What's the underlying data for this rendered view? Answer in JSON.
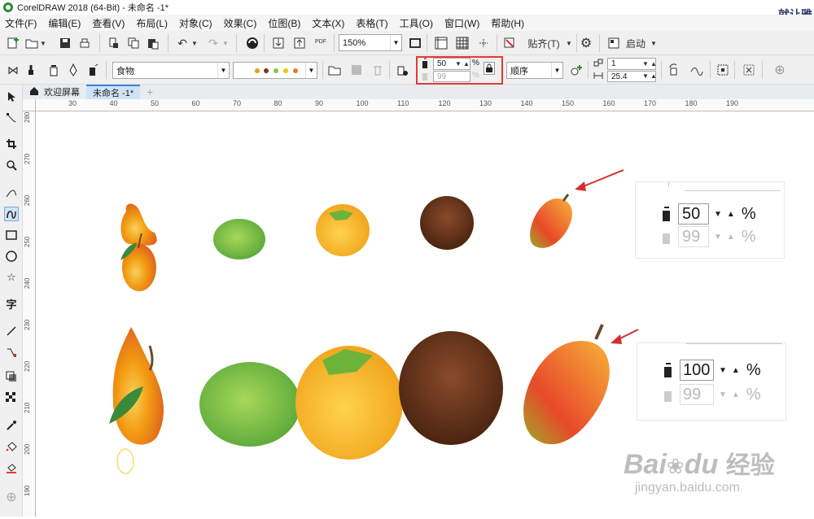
{
  "window": {
    "title": "CorelDRAW 2018 (64-Bit) - 未命名 -1*",
    "corner_text": "就让雅"
  },
  "menu": [
    "文件(F)",
    "编辑(E)",
    "查看(V)",
    "布局(L)",
    "对象(C)",
    "效果(C)",
    "位图(B)",
    "文本(X)",
    "表格(T)",
    "工具(O)",
    "窗口(W)",
    "帮助(H)"
  ],
  "standard_toolbar": {
    "zoom": "150%",
    "pdf_label": "PDF",
    "snap_label": "贴齐(T)",
    "launch_label": "启动"
  },
  "property_bar": {
    "symmetry_type": "食物",
    "brush_preview": "",
    "smoothing_value": "50",
    "smoothing_second": "99",
    "percent": "%",
    "order": "顺序",
    "count_value": "1",
    "size_value": "25.4"
  },
  "doc_tabs": [
    {
      "label": "欢迎屏幕"
    },
    {
      "label": "未命名 -1*"
    }
  ],
  "ruler": {
    "h_ticks": [
      "30",
      "40",
      "50",
      "60",
      "70",
      "80",
      "90",
      "100",
      "110",
      "120",
      "130",
      "140",
      "150",
      "160",
      "170",
      "180",
      "190"
    ],
    "v_ticks": [
      "280",
      "270",
      "260",
      "250",
      "240",
      "230",
      "220",
      "210",
      "200",
      "190"
    ]
  },
  "insets": [
    {
      "primary": "50",
      "secondary": "99",
      "pct": "%"
    },
    {
      "primary": "100",
      "secondary": "99",
      "pct": "%"
    }
  ],
  "watermark": {
    "brand": "Bai",
    "brand2": "du",
    "cn": "经验",
    "url": "jingyan.baidu.com"
  },
  "colors": {
    "highlight_red": "#e53935",
    "arrow_red": "#d32f2f"
  }
}
